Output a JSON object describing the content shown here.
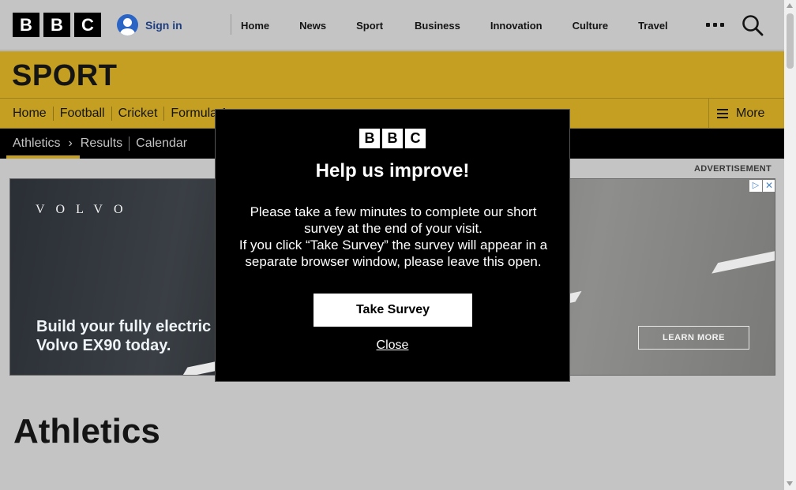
{
  "masthead": {
    "logo_letters": [
      "B",
      "B",
      "C"
    ],
    "signin_label": "Sign in",
    "nav": [
      "Home",
      "News",
      "Sport",
      "Business",
      "Innovation",
      "Culture",
      "Travel"
    ]
  },
  "sport": {
    "title": "SPORT",
    "nav": [
      "Home",
      "Football",
      "Cricket",
      "Formula 1"
    ],
    "more_label": "More"
  },
  "subnav": {
    "active": "Athletics",
    "items": [
      "Results",
      "Calendar"
    ]
  },
  "ad": {
    "label": "ADVERTISEMENT",
    "brand": "VOLVO",
    "headline_line1": "Build your fully electric",
    "headline_line2": "Volvo EX90 today.",
    "cta": "LEARN MORE",
    "choice_glyph": "▷",
    "close_glyph": "✕"
  },
  "page": {
    "title": "Athletics"
  },
  "modal": {
    "logo_letters": [
      "B",
      "B",
      "C"
    ],
    "heading": "Help us improve!",
    "body_line1": "Please take a few minutes to complete our short survey at the end of your visit.",
    "body_line2": "If you click “Take Survey” the survey will appear in a separate browser window, please leave this open.",
    "primary_button": "Take Survey",
    "close_link": "Close"
  },
  "colors": {
    "sport_yellow": "#c49f22",
    "signin_blue": "#2a64c4",
    "modal_bg": "#000000"
  }
}
